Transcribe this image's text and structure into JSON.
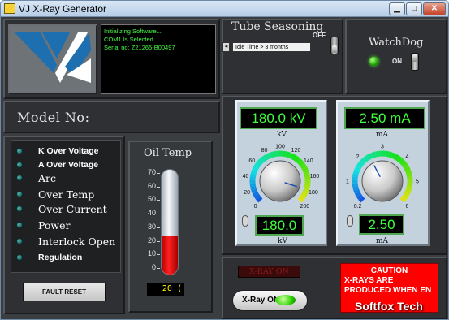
{
  "window": {
    "title": "VJ X-Ray Generator",
    "icon": "labview-icon"
  },
  "status_screen": [
    "Initializing Software...",
    "COM1 Is Selected",
    "Serial no: Z21265-B00497"
  ],
  "model": {
    "label": "Model No:"
  },
  "alarms": [
    {
      "label": "K Over Voltage",
      "style": "sans"
    },
    {
      "label": "A Over Voltage",
      "style": "sans"
    },
    {
      "label": "Arc",
      "style": "serif"
    },
    {
      "label": "Over Temp",
      "style": "serif"
    },
    {
      "label": "Over Current",
      "style": "serif"
    },
    {
      "label": "Power",
      "style": "serif"
    },
    {
      "label": "Interlock Open",
      "style": "serif"
    },
    {
      "label": "Regulation",
      "style": "sans"
    }
  ],
  "fault_reset": {
    "label": "FAULT RESET"
  },
  "oil_temp": {
    "title": "Oil Temp",
    "ticks": [
      "70",
      "60",
      "50",
      "40",
      "30",
      "20",
      "10",
      "0"
    ],
    "level": 20,
    "max": 70,
    "value_display": "20 ("
  },
  "tube_seasoning": {
    "title": "Tube Seasoning",
    "switch_label": "OFF",
    "idle_time": "Idle Time > 3 months"
  },
  "watchdog": {
    "title": "WatchDog",
    "switch_label": "ON"
  },
  "kv": {
    "display": "180.0 kV",
    "unit_top": "kV",
    "scale": [
      "0",
      "20",
      "40",
      "60",
      "80",
      "100",
      "120",
      "140",
      "160",
      "180",
      "200"
    ],
    "min": 0,
    "max": 200,
    "value": 180,
    "control_value": "180.0",
    "unit_bottom": "kV"
  },
  "ma": {
    "display": "2.50 mA",
    "unit_top": "mA",
    "scale": [
      "0.2",
      "1",
      "2",
      "3",
      "4",
      "5",
      "6"
    ],
    "min": 0.2,
    "max": 6,
    "value": 2.5,
    "control_value": "2.50",
    "unit_bottom": "mA"
  },
  "xray": {
    "indicator": "X-RAY ON",
    "button_label": "X-Ray ON"
  },
  "caution": {
    "title": "CAUTION",
    "body": "X-RAYS ARE PRODUCED WHEN EN"
  },
  "watermark": "Softfox Tech",
  "colors": {
    "background": "#3b3e41",
    "lcd_text": "#3dff3d",
    "caution": "#ff0000",
    "led_green": "#1ca600"
  }
}
